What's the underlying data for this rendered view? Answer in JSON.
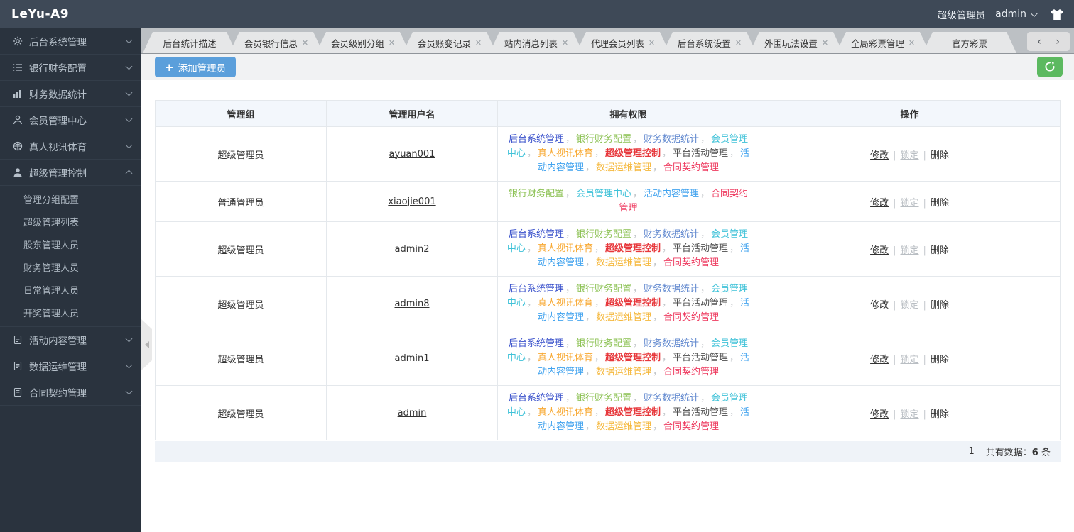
{
  "header": {
    "logo": "LeYu-A9",
    "role": "超级管理员",
    "username": "admin"
  },
  "sidebar": {
    "items": [
      {
        "label": "后台系统管理",
        "icon": "gear-icon",
        "expanded": false,
        "children": []
      },
      {
        "label": "银行财务配置",
        "icon": "list-icon",
        "expanded": false,
        "children": []
      },
      {
        "label": "财务数据统计",
        "icon": "chart-icon",
        "expanded": false,
        "children": []
      },
      {
        "label": "会员管理中心",
        "icon": "user-icon",
        "expanded": false,
        "children": []
      },
      {
        "label": "真人视讯体育",
        "icon": "sports-icon",
        "expanded": false,
        "children": []
      },
      {
        "label": "超级管理控制",
        "icon": "admin-icon",
        "expanded": true,
        "children": [
          "管理分组配置",
          "超级管理列表",
          "股东管理人员",
          "财务管理人员",
          "日常管理人员",
          "开奖管理人员"
        ]
      },
      {
        "label": "活动内容管理",
        "icon": "doc-icon",
        "expanded": false,
        "children": []
      },
      {
        "label": "数据运维管理",
        "icon": "doc-icon",
        "expanded": false,
        "children": []
      },
      {
        "label": "合同契约管理",
        "icon": "doc-icon",
        "expanded": false,
        "children": []
      }
    ]
  },
  "tabs": [
    {
      "label": "后台统计描述",
      "closable": false
    },
    {
      "label": "会员银行信息",
      "closable": true
    },
    {
      "label": "会员级别分组",
      "closable": true
    },
    {
      "label": "会员账变记录",
      "closable": true
    },
    {
      "label": "站内消息列表",
      "closable": true
    },
    {
      "label": "代理会员列表",
      "closable": true
    },
    {
      "label": "后台系统设置",
      "closable": true
    },
    {
      "label": "外围玩法设置",
      "closable": true
    },
    {
      "label": "全局彩票管理",
      "closable": true
    },
    {
      "label": "官方彩票",
      "closable": false
    }
  ],
  "toolbar": {
    "add_label": "添加管理员"
  },
  "table": {
    "columns": [
      "管理组",
      "管理用户名",
      "拥有权限",
      "操作"
    ],
    "actions": {
      "edit": "修改",
      "lock": "锁定",
      "delete": "删除"
    },
    "permission_styles": {
      "后台系统管理": {
        "color": "#3d54cc",
        "bold": false
      },
      "银行财务配置": {
        "color": "#8bc152",
        "bold": false
      },
      "财务数据统计": {
        "color": "#6289cf",
        "bold": false
      },
      "会员管理中心": {
        "color": "#3fc2d8",
        "bold": false
      },
      "真人视讯体育": {
        "color": "#f8a933",
        "bold": false
      },
      "超级管理控制": {
        "color": "#e7383c",
        "bold": true
      },
      "平台活动管理": {
        "color": "#4f4f4f",
        "bold": false
      },
      "活动内容管理": {
        "color": "#44a4ef",
        "bold": false
      },
      "数据运维管理": {
        "color": "#f5b83d",
        "bold": false
      },
      "合同契约管理": {
        "color": "#ee3a5f",
        "bold": false
      }
    },
    "rows": [
      {
        "group": "超级管理员",
        "username": "ayuan001",
        "permissions": [
          "后台系统管理",
          "银行财务配置",
          "财务数据统计",
          "会员管理中心",
          "真人视讯体育",
          "超级管理控制",
          "平台活动管理",
          "活动内容管理",
          "数据运维管理",
          "合同契约管理"
        ]
      },
      {
        "group": "普通管理员",
        "username": "xiaojie001",
        "permissions": [
          "银行财务配置",
          "会员管理中心",
          "活动内容管理",
          "合同契约管理"
        ]
      },
      {
        "group": "超级管理员",
        "username": "admin2",
        "permissions": [
          "后台系统管理",
          "银行财务配置",
          "财务数据统计",
          "会员管理中心",
          "真人视讯体育",
          "超级管理控制",
          "平台活动管理",
          "活动内容管理",
          "数据运维管理",
          "合同契约管理"
        ]
      },
      {
        "group": "超级管理员",
        "username": "admin8",
        "permissions": [
          "后台系统管理",
          "银行财务配置",
          "财务数据统计",
          "会员管理中心",
          "真人视讯体育",
          "超级管理控制",
          "平台活动管理",
          "活动内容管理",
          "数据运维管理",
          "合同契约管理"
        ]
      },
      {
        "group": "超级管理员",
        "username": "admin1",
        "permissions": [
          "后台系统管理",
          "银行财务配置",
          "财务数据统计",
          "会员管理中心",
          "真人视讯体育",
          "超级管理控制",
          "平台活动管理",
          "活动内容管理",
          "数据运维管理",
          "合同契约管理"
        ]
      },
      {
        "group": "超级管理员",
        "username": "admin",
        "permissions": [
          "后台系统管理",
          "银行财务配置",
          "财务数据统计",
          "会员管理中心",
          "真人视讯体育",
          "超级管理控制",
          "平台活动管理",
          "活动内容管理",
          "数据运维管理",
          "合同契约管理"
        ]
      }
    ]
  },
  "pagination": {
    "page": "1",
    "label_prefix": "共有数据：",
    "count": "6",
    "unit": "条"
  }
}
